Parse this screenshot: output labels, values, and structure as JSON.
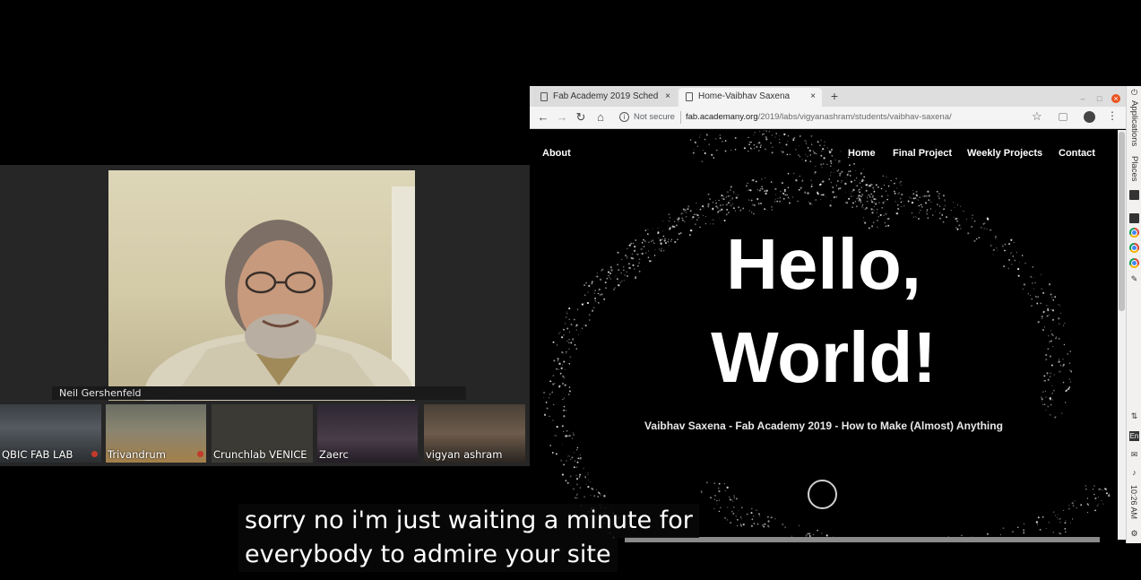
{
  "call": {
    "speaker_name": "Neil Gershenfeld",
    "participants": [
      {
        "label": "QBIC FAB LAB"
      },
      {
        "label": "Trivandrum"
      },
      {
        "label": "Crunchlab VENICE"
      },
      {
        "label": "Zaerc"
      },
      {
        "label": "vigyan ashram"
      }
    ]
  },
  "browser": {
    "tabs": [
      {
        "title": "Fab Academy 2019 Sched",
        "close": "×"
      },
      {
        "title": "Home-Vaibhav Saxena",
        "close": "×"
      }
    ],
    "new_tab": "+",
    "security_label": "Not secure",
    "url_host": "fab.academany.org",
    "url_path": "/2019/labs/vigyanashram/students/vaibhav-saxena/"
  },
  "site": {
    "nav": {
      "about": "About",
      "home": "Home",
      "final_project": "Final Project",
      "weekly_projects": "Weekly Projects",
      "contact": "Contact"
    },
    "hero_line1": "Hello,",
    "hero_line2": "World!",
    "subtitle": "Vaibhav Saxena - Fab Academy 2019 - How to Make (Almost) Anything"
  },
  "os_panel": {
    "applications": "Applications",
    "places": "Places",
    "keyboard": "En",
    "clock": "10:26 AM"
  },
  "caption": {
    "line1": "sorry no i'm just waiting a minute for",
    "line2": "everybody to admire your site"
  }
}
